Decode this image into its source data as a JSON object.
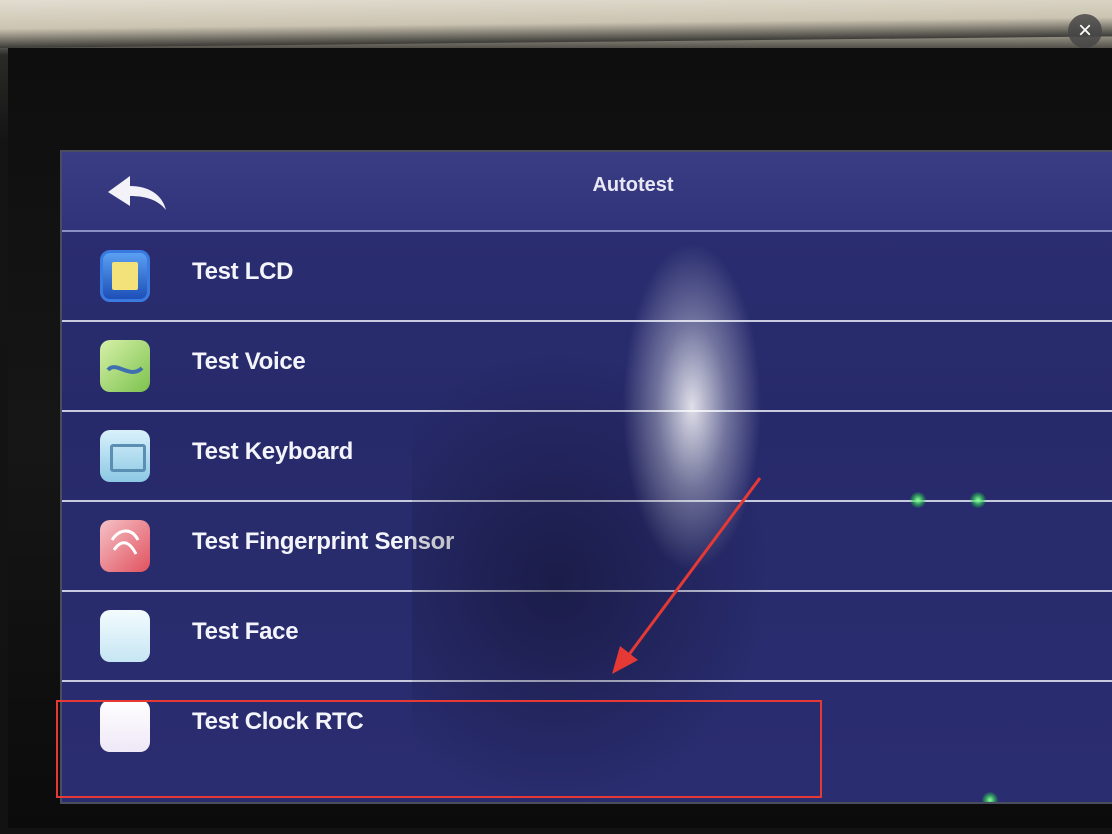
{
  "viewer": {
    "close_icon": "close-icon",
    "close_glyph": "×"
  },
  "screen": {
    "title": "Autotest",
    "back_icon": "back-arrow-icon",
    "items": [
      {
        "label": "Test LCD",
        "icon": "lcd-icon",
        "icon_color": "#2b6fd6"
      },
      {
        "label": "Test Voice",
        "icon": "voice-icon",
        "icon_color": "#9fd27a"
      },
      {
        "label": "Test Keyboard",
        "icon": "keyboard-icon",
        "icon_color": "#a9d8ea"
      },
      {
        "label": "Test Fingerprint Sensor",
        "icon": "fingerprint-icon",
        "icon_color": "#e8707a"
      },
      {
        "label": "Test Face",
        "icon": "face-icon",
        "icon_color": "#dff2fb"
      },
      {
        "label": "Test Clock RTC",
        "icon": "clock-icon",
        "icon_color": "#f5f0fb"
      }
    ]
  },
  "annotation": {
    "highlight_color": "#e53935",
    "highlighted_item": "Test Clock RTC"
  }
}
